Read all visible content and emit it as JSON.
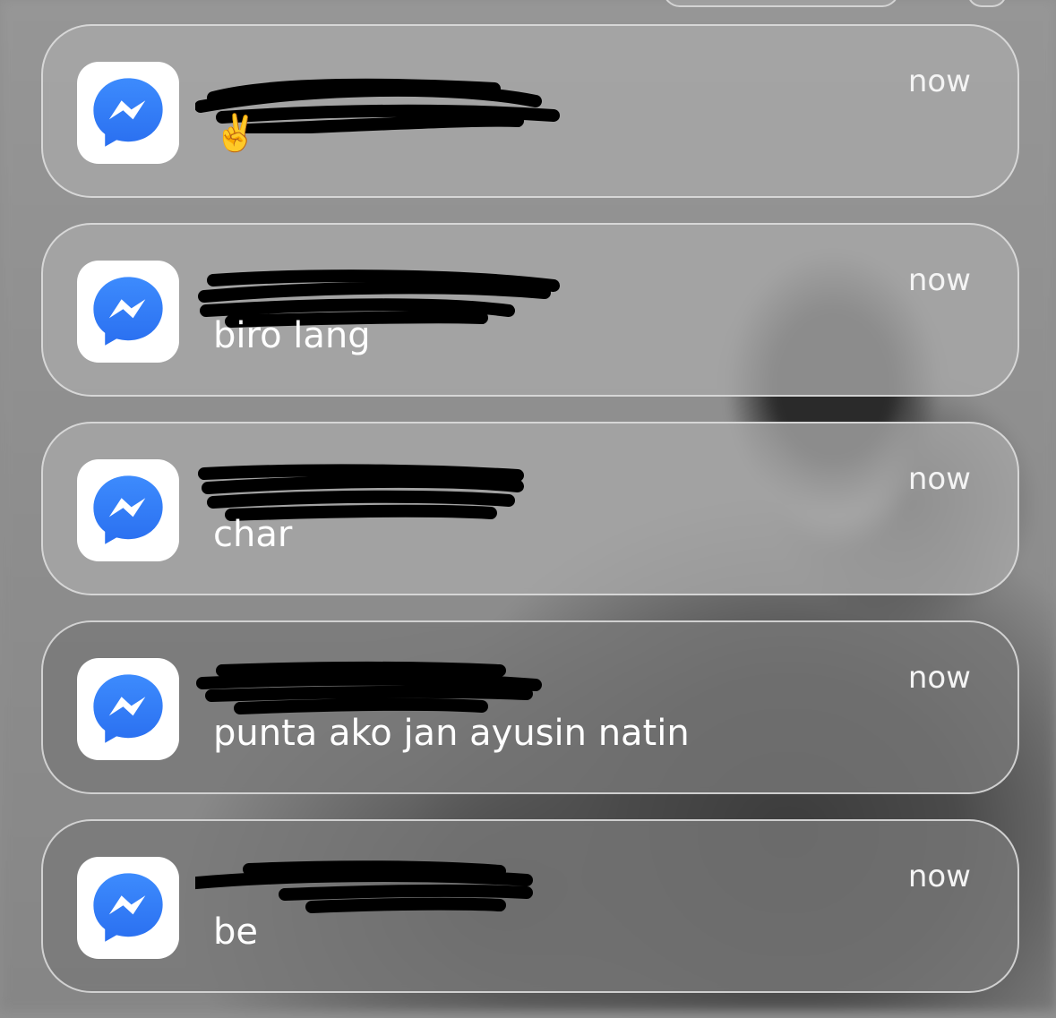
{
  "colors": {
    "card_bg": "#a8a8a8",
    "text": "#ffffff",
    "icon_bg": "#ffffff",
    "icon_blue": "#2f7bf5",
    "redaction": "#000000"
  },
  "notifications": [
    {
      "app": "messenger-icon",
      "sender": "",
      "message": "✌️",
      "time": "now"
    },
    {
      "app": "messenger-icon",
      "sender": "",
      "message": "biro lang",
      "time": "now"
    },
    {
      "app": "messenger-icon",
      "sender": "",
      "message": "char",
      "time": "now"
    },
    {
      "app": "messenger-icon",
      "sender": "",
      "message": "punta ako jan ayusin natin",
      "time": "now"
    },
    {
      "app": "messenger-icon",
      "sender": "",
      "message": "be",
      "time": "now"
    }
  ]
}
